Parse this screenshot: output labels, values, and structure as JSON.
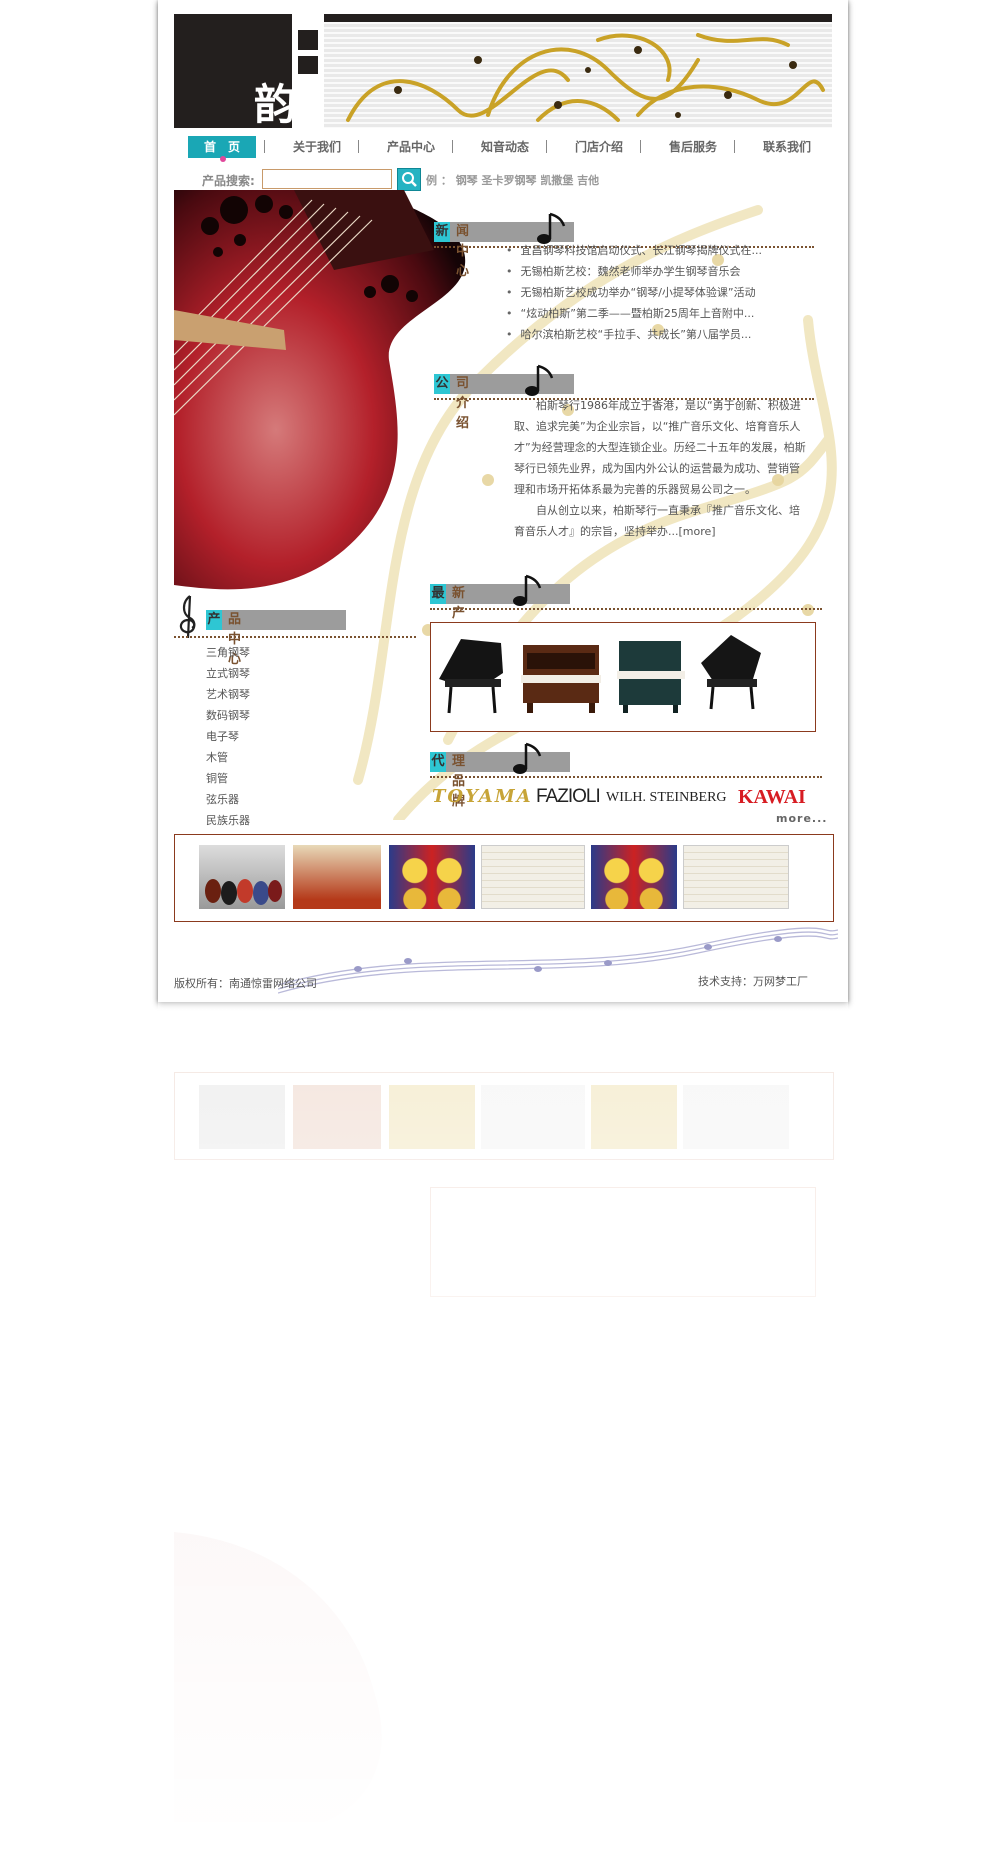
{
  "header": {
    "logo_char": "韵"
  },
  "nav": {
    "items": [
      "首　页",
      "关于我们",
      "产品中心",
      "知音动态",
      "门店介绍",
      "售后服务",
      "联系我们"
    ]
  },
  "search": {
    "label": "产品搜索:",
    "value": "",
    "example_prefix": "例 ：",
    "examples": "钢琴  圣卡罗钢琴  凯撒堡  吉他"
  },
  "news": {
    "title_cap": "新",
    "title_rest": "闻中心",
    "items": [
      "宜昌钢琴科技馆启动仪式、长江钢琴揭牌仪式在...",
      "无锡柏斯艺校：魏然老师举办学生钢琴音乐会",
      "无锡柏斯艺校成功举办“钢琴/小提琴体验课”活动",
      "“炫动柏斯”第二季——暨柏斯25周年上音附中...",
      "哈尔滨柏斯艺校“手拉手、共成长”第八届学员..."
    ]
  },
  "about": {
    "title_cap": "公",
    "title_rest": "司介绍",
    "para1": "柏斯琴行1986年成立于香港，是以“勇于创新、积极进取、追求完美”为企业宗旨，以“推广音乐文化、培育音乐人才”为经营理念的大型连锁企业。历经二十五年的发展，柏斯琴行已领先业界，成为国内外公认的运营最为成功、营销管理和市场开拓体系最为完善的乐器贸易公司之一。",
    "para2": "自从创立以来，柏斯琴行一直秉承『推广音乐文化、培育音乐人才』的宗旨，坚持举办...",
    "more": "[more]"
  },
  "products": {
    "title_cap": "产",
    "title_rest": "品中心",
    "categories": [
      "三角钢琴",
      "立式钢琴",
      "艺术钢琴",
      "数码钢琴",
      "电子琴",
      "木管",
      "铜管",
      "弦乐器",
      "民族乐器"
    ]
  },
  "new_products": {
    "title_cap": "最",
    "title_rest": "新产品"
  },
  "brands": {
    "title_cap": "代",
    "title_rest": "理品牌",
    "names": [
      "TOYAMA",
      "FAZIOLI",
      "WILH. STEINBERG",
      "KAWAI"
    ],
    "more": "more..."
  },
  "footer": {
    "copyright": "版权所有：南通惊雷网络公司",
    "support": "技术支持：万网梦工厂"
  },
  "colors": {
    "accent": "#1aa7b5",
    "brown": "#8b3a1e",
    "dark": "#231f1e"
  },
  "icons": [
    "search-icon",
    "music-note-icon",
    "treble-clef-icon"
  ]
}
